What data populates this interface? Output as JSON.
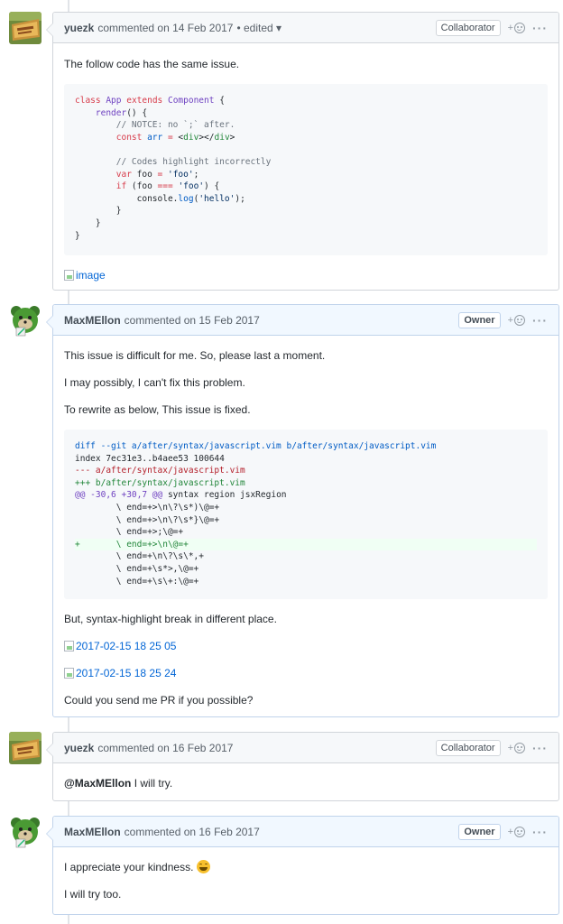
{
  "comments": [
    {
      "author": "yuezk",
      "meta": "commented on 14 Feb 2017",
      "edited": "• edited ▾",
      "label": "Collaborator",
      "body": {
        "p1": "The follow code has the same issue.",
        "image_alt": "image"
      }
    },
    {
      "author": "MaxMEllon",
      "meta": "commented on 15 Feb 2017",
      "label": "Owner",
      "body": {
        "p1": "This issue is difficult for me. So, please last a moment.",
        "p2": "I may possibly, I can't fix this problem.",
        "p3": "To rewrite as below, This issue is fixed.",
        "p4": "But, syntax-highlight break in different place.",
        "image1_alt": "2017-02-15 18 25 05",
        "image2_alt": "2017-02-15 18 25 24",
        "p5": "Could you send me PR if you possible?"
      }
    },
    {
      "author": "yuezk",
      "meta": "commented on 16 Feb 2017",
      "label": "Collaborator",
      "body": {
        "mention": "@MaxMEllon",
        "text": " I will try."
      }
    },
    {
      "author": "MaxMEllon",
      "meta": "commented on 16 Feb 2017",
      "label": "Owner",
      "body": {
        "p1": "I appreciate your kindness. ",
        "p2": "I will try too."
      }
    }
  ],
  "reaction_plus": "+",
  "more_dots": "···",
  "code1": {
    "l1a": "class ",
    "l1b": "App ",
    "l1c": "extends ",
    "l1d": "Component",
    "l1e": " {",
    "l2a": "    render",
    "l2b": "() {",
    "l3": "        // NOTCE: no `;` after.",
    "l4a": "        const ",
    "l4b": "arr",
    "l4c": " = ",
    "l4d": "<",
    "l4e": "div",
    "l4f": "></",
    "l4g": "div",
    "l4h": ">",
    "l5": "",
    "l6": "        // Codes highlight incorrectly",
    "l7a": "        var ",
    "l7b": "foo",
    "l7c": " = ",
    "l7d": "'foo'",
    "l7e": ";",
    "l8a": "        if ",
    "l8b": "(foo ",
    "l8c": "===",
    "l8d": " ",
    "l8e": "'foo'",
    "l8f": ") {",
    "l9a": "            console",
    "l9b": ".",
    "l9c": "log",
    "l9d": "(",
    "l9e": "'hello'",
    "l9f": ");",
    "l10": "        }",
    "l11": "    }",
    "l12": "}"
  },
  "code2": {
    "l1": "diff --git a/after/syntax/javascript.vim b/after/syntax/javascript.vim",
    "l2": "index 7ec31e3..b4aee53 100644",
    "l3": "--- a/after/syntax/javascript.vim",
    "l4": "+++ b/after/syntax/javascript.vim",
    "l5a": "@@ -30,6 +30,7 @@",
    "l5b": " syntax region jsxRegion",
    "l6": "        \\ end=+>\\n\\?\\s*)\\@=+",
    "l7": "        \\ end=+>\\n\\?\\s*}\\@=+",
    "l8": "        \\ end=+>;\\@=+",
    "l9": "+       \\ end=+>\\n\\@=+",
    "l10": "        \\ end=+\\n\\?\\s\\*,+",
    "l11": "        \\ end=+\\s*>,\\@=+",
    "l12": "        \\ end=+\\s\\+:\\@=+"
  }
}
